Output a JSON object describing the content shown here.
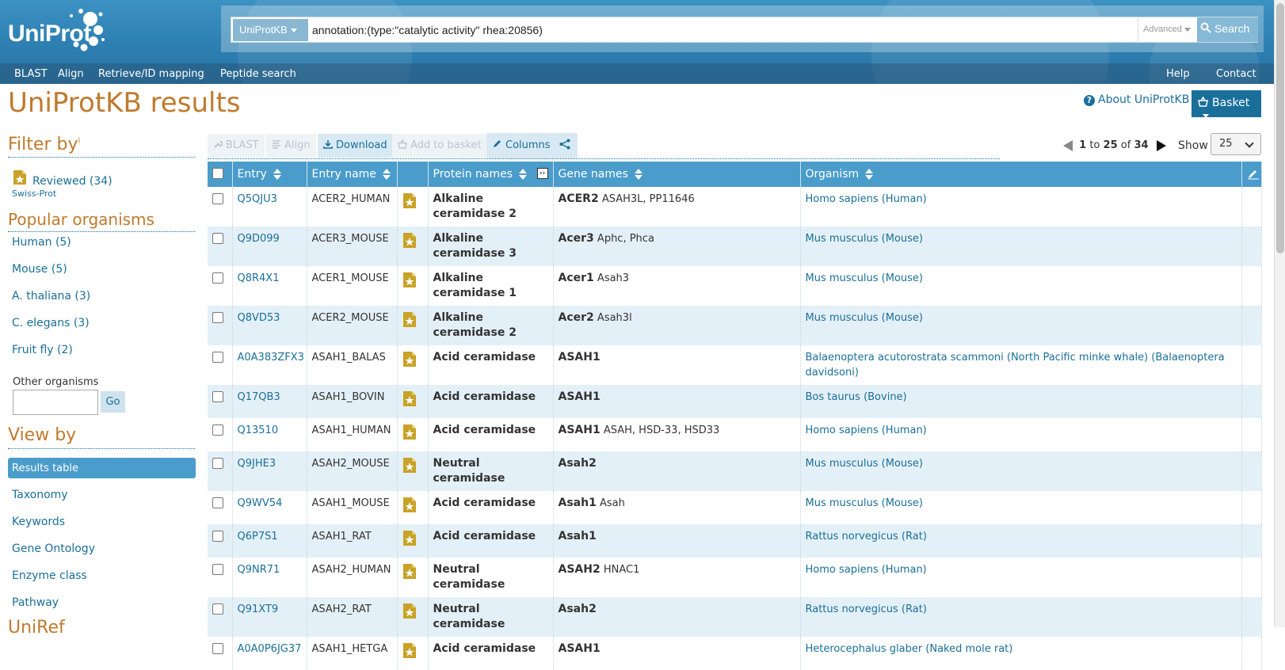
{
  "header": {
    "logo_text": "UniProt",
    "search": {
      "db_label": "UniProtKB",
      "query": "annotation:(type:\"catalytic activity\" rhea:20856)",
      "advanced_label": "Advanced",
      "button_label": "Search"
    },
    "nav_left": [
      "BLAST",
      "Align",
      "Retrieve/ID mapping",
      "Peptide search"
    ],
    "nav_right": [
      "Help",
      "Contact"
    ]
  },
  "page": {
    "title": "UniProtKB results",
    "about_link": "About UniProtKB",
    "basket_label": "Basket"
  },
  "sidebar": {
    "filter_heading": "Filter by",
    "filter_sup": "i",
    "reviewed_label": "Reviewed (34)",
    "swissprot_label": "Swiss-Prot",
    "popular_heading": "Popular organisms",
    "organisms": [
      "Human (5)",
      "Mouse (5)",
      "A. thaliana (3)",
      "C. elegans (3)",
      "Fruit fly (2)"
    ],
    "other_label": "Other organisms",
    "go_label": "Go",
    "viewby_heading": "View by",
    "views": [
      "Results table",
      "Taxonomy",
      "Keywords",
      "Gene Ontology",
      "Enzyme class",
      "Pathway"
    ],
    "cutoff_heading": "UniRef"
  },
  "toolbar": {
    "blast": "BLAST",
    "align": "Align",
    "download": "Download",
    "add_to_basket": "Add to basket",
    "columns": "Columns"
  },
  "pager": {
    "from": "1",
    "to_word": "to",
    "to": "25",
    "of_word": "of",
    "total": "34",
    "show_label": "Show",
    "page_size": "25"
  },
  "table": {
    "headers": [
      "Entry",
      "Entry name",
      "Protein names",
      "Gene names",
      "Organism"
    ],
    "rows": [
      {
        "entry": "Q5QJU3",
        "name": "ACER2_HUMAN",
        "protein": "Alkaline ceramidase 2",
        "gene": "ACER2",
        "gene_extra": "ASAH3L, PP11646",
        "organism": "Homo sapiens (Human)"
      },
      {
        "entry": "Q9D099",
        "name": "ACER3_MOUSE",
        "protein": "Alkaline ceramidase 3",
        "gene": "Acer3",
        "gene_extra": "Aphc, Phca",
        "organism": "Mus musculus (Mouse)"
      },
      {
        "entry": "Q8R4X1",
        "name": "ACER1_MOUSE",
        "protein": "Alkaline ceramidase 1",
        "gene": "Acer1",
        "gene_extra": "Asah3",
        "organism": "Mus musculus (Mouse)"
      },
      {
        "entry": "Q8VD53",
        "name": "ACER2_MOUSE",
        "protein": "Alkaline ceramidase 2",
        "gene": "Acer2",
        "gene_extra": "Asah3l",
        "organism": "Mus musculus (Mouse)"
      },
      {
        "entry": "A0A383ZFX3",
        "name": "ASAH1_BALAS",
        "protein": "Acid ceramidase",
        "gene": "ASAH1",
        "gene_extra": "",
        "organism": "Balaenoptera acutorostrata scammoni (North Pacific minke whale) (Balaenoptera davidsoni)"
      },
      {
        "entry": "Q17QB3",
        "name": "ASAH1_BOVIN",
        "protein": "Acid ceramidase",
        "gene": "ASAH1",
        "gene_extra": "",
        "organism": "Bos taurus (Bovine)"
      },
      {
        "entry": "Q13510",
        "name": "ASAH1_HUMAN",
        "protein": "Acid ceramidase",
        "gene": "ASAH1",
        "gene_extra": "ASAH, HSD-33, HSD33",
        "organism": "Homo sapiens (Human)"
      },
      {
        "entry": "Q9JHE3",
        "name": "ASAH2_MOUSE",
        "protein": "Neutral ceramidase",
        "gene": "Asah2",
        "gene_extra": "",
        "organism": "Mus musculus (Mouse)"
      },
      {
        "entry": "Q9WV54",
        "name": "ASAH1_MOUSE",
        "protein": "Acid ceramidase",
        "gene": "Asah1",
        "gene_extra": "Asah",
        "organism": "Mus musculus (Mouse)"
      },
      {
        "entry": "Q6P7S1",
        "name": "ASAH1_RAT",
        "protein": "Acid ceramidase",
        "gene": "Asah1",
        "gene_extra": "",
        "organism": "Rattus norvegicus (Rat)"
      },
      {
        "entry": "Q9NR71",
        "name": "ASAH2_HUMAN",
        "protein": "Neutral ceramidase",
        "gene": "ASAH2",
        "gene_extra": "HNAC1",
        "organism": "Homo sapiens (Human)"
      },
      {
        "entry": "Q91XT9",
        "name": "ASAH2_RAT",
        "protein": "Neutral ceramidase",
        "gene": "Asah2",
        "gene_extra": "",
        "organism": "Rattus norvegicus (Rat)"
      },
      {
        "entry": "A0A0P6JG37",
        "name": "ASAH1_HETGA",
        "protein": "Acid ceramidase",
        "gene": "ASAH1",
        "gene_extra": "",
        "organism": "Heterocephalus glaber (Naked mole rat)"
      }
    ]
  },
  "colors": {
    "brand_blue": "#4a9ccb",
    "link": "#1a6f9a",
    "title_orange": "#c07a2d",
    "reviewed_gold": "#c9a227"
  }
}
